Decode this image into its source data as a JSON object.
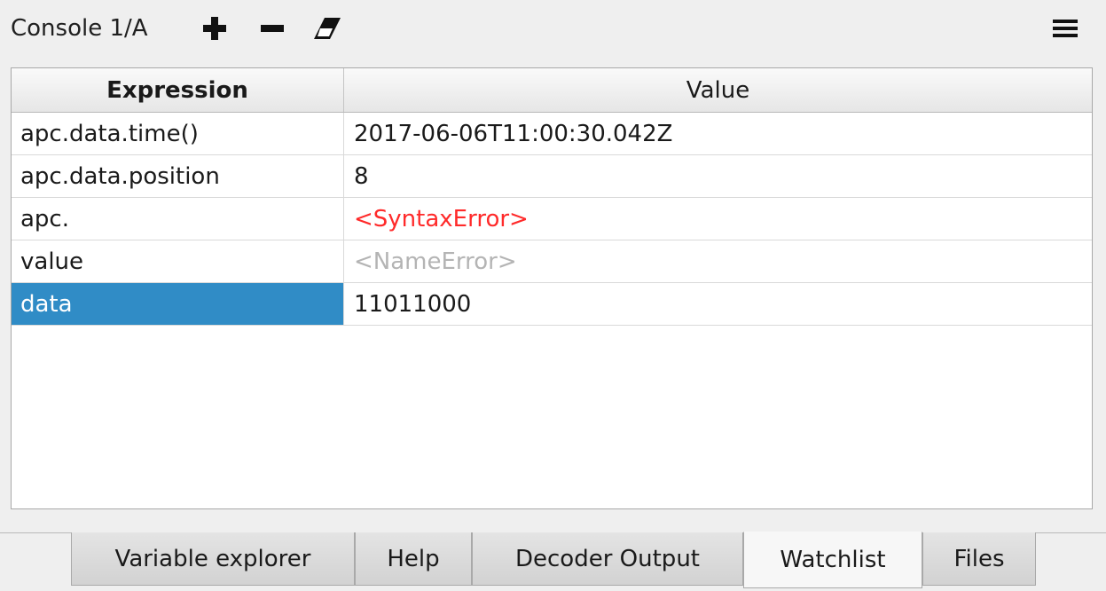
{
  "toolbar": {
    "console_title": "Console 1/A",
    "buttons": [
      {
        "name": "add-icon",
        "glyph": "plus"
      },
      {
        "name": "remove-icon",
        "glyph": "minus"
      },
      {
        "name": "clear-icon",
        "glyph": "eraser"
      },
      {
        "name": "menu-icon",
        "glyph": "hamburger"
      }
    ]
  },
  "table": {
    "headers": {
      "expression": "Expression",
      "value": "Value"
    },
    "rows": [
      {
        "expression": "apc.data.time()",
        "value": "2017-06-06T11:00:30.042Z",
        "status": "normal"
      },
      {
        "expression": "apc.data.position",
        "value": "8",
        "status": "normal"
      },
      {
        "expression": "apc.",
        "value": "<SyntaxError>",
        "status": "error"
      },
      {
        "expression": "value",
        "value": "<NameError>",
        "status": "muted"
      },
      {
        "expression": "data",
        "value": "11011000",
        "status": "selected"
      }
    ]
  },
  "tabs": [
    {
      "label": "Variable explorer",
      "active": false
    },
    {
      "label": "Help",
      "active": false
    },
    {
      "label": "Decoder Output",
      "active": false
    },
    {
      "label": "Watchlist",
      "active": true
    },
    {
      "label": "Files",
      "active": false
    }
  ],
  "colors": {
    "selection": "#308cc6",
    "error": "#ff2a2a",
    "muted": "#b4b4b4"
  }
}
